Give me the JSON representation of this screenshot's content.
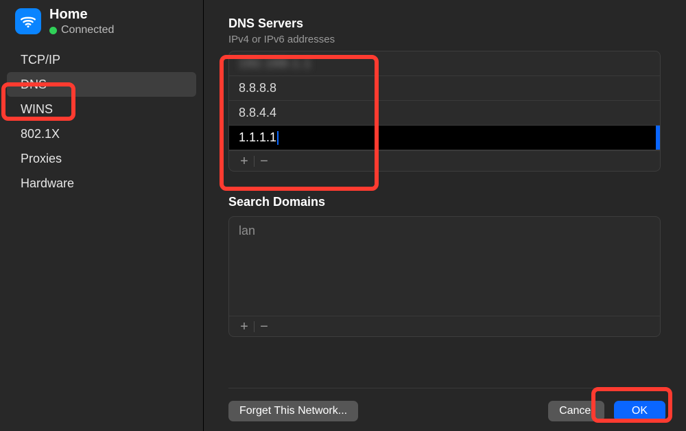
{
  "network": {
    "name": "Home",
    "status": "Connected",
    "status_color": "#30d158"
  },
  "sidebar": {
    "tabs": [
      {
        "id": "tcpip",
        "label": "TCP/IP"
      },
      {
        "id": "dns",
        "label": "DNS",
        "selected": true
      },
      {
        "id": "wins",
        "label": "WINS"
      },
      {
        "id": "8021x",
        "label": "802.1X"
      },
      {
        "id": "proxies",
        "label": "Proxies"
      },
      {
        "id": "hardware",
        "label": "Hardware"
      }
    ]
  },
  "dns": {
    "title": "DNS Servers",
    "subtitle": "IPv4 or IPv6 addresses",
    "servers": [
      {
        "value": "192.168.1.1",
        "obscured": true
      },
      {
        "value": "8.8.8.8"
      },
      {
        "value": "8.8.4.4"
      },
      {
        "value": "1.1.1.1",
        "editing": true
      }
    ],
    "add_label": "+",
    "remove_label": "−"
  },
  "search": {
    "title": "Search Domains",
    "items": [
      {
        "value": "lan"
      }
    ],
    "add_label": "+",
    "remove_label": "−"
  },
  "footer": {
    "forget_label": "Forget This Network...",
    "cancel_label": "Cancel",
    "ok_label": "OK"
  }
}
